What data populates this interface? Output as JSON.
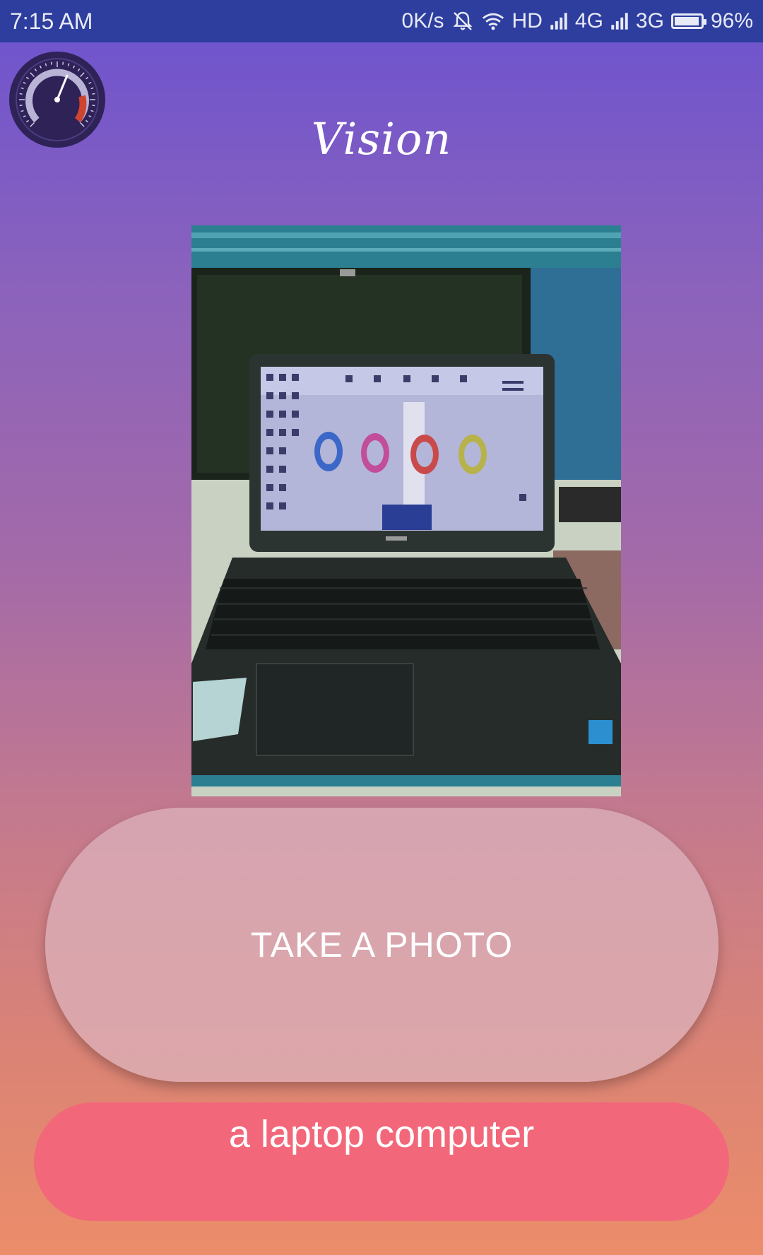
{
  "status_bar": {
    "time": "7:15 AM",
    "net_speed": "0K/s",
    "net_hd": "HD",
    "net_4g": "4G",
    "net_3g": "3G",
    "battery": "96%",
    "battery_level": 0.96,
    "icons": [
      "bell-off-icon",
      "wifi-icon",
      "signal-icon",
      "battery-icon"
    ]
  },
  "app": {
    "title": "Vision",
    "gauge_icon": "speedometer-icon"
  },
  "photo": {
    "subject": "laptop-photo"
  },
  "actions": {
    "take_photo_label": "TAKE A PHOTO"
  },
  "result": {
    "caption": "a laptop computer"
  },
  "colors": {
    "status_bar": "#2d3e9e",
    "gradient_top": "#6b52cf",
    "gradient_bottom": "#ec8d6a",
    "button": "#dcb4be",
    "result_pill": "#f2687a"
  }
}
